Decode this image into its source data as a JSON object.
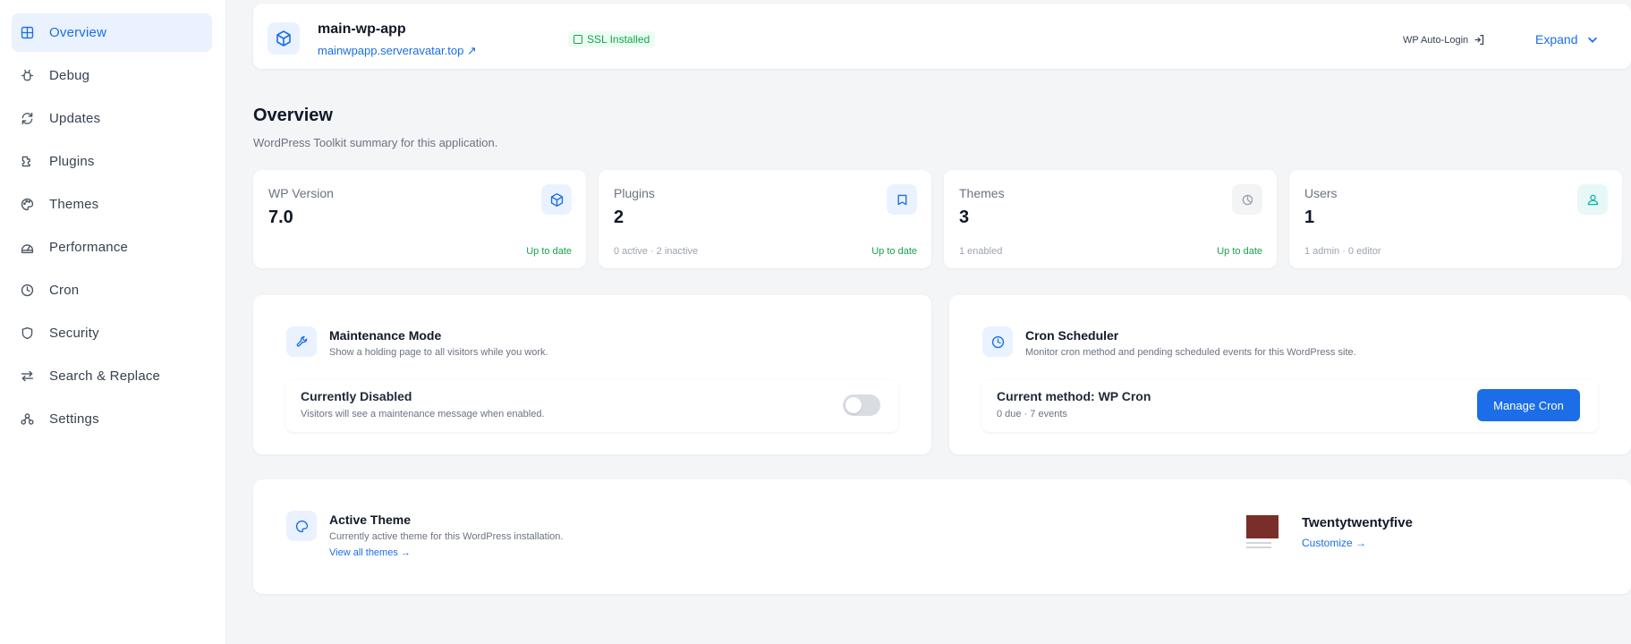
{
  "sidebar": {
    "items": [
      {
        "label": "Overview",
        "icon": "grid-icon",
        "active": true
      },
      {
        "label": "Debug",
        "icon": "bug-icon"
      },
      {
        "label": "Updates",
        "icon": "refresh-icon"
      },
      {
        "label": "Plugins",
        "icon": "puzzle-icon"
      },
      {
        "label": "Themes",
        "icon": "palette-icon"
      },
      {
        "label": "Performance",
        "icon": "gauge-icon"
      },
      {
        "label": "Cron",
        "icon": "clock-icon"
      },
      {
        "label": "Security",
        "icon": "shield-icon"
      },
      {
        "label": "Search & Replace",
        "icon": "swap-icon"
      },
      {
        "label": "Settings",
        "icon": "settings-icon"
      }
    ]
  },
  "header": {
    "app_name": "main-wp-app",
    "domain": "mainwpapp.serveravatar.top ↗",
    "ssl_badge": "SSL Installed",
    "wp_login": "WP Auto-Login",
    "expand": "Expand"
  },
  "overview": {
    "title": "Overview",
    "subtitle": "WordPress Toolkit summary for this application."
  },
  "stats": [
    {
      "label": "WP Version",
      "value": "7.0",
      "note": "",
      "status": "Up to date",
      "icon": "cube-icon",
      "icon_bg": "#eaf2ff",
      "icon_color": "#1b6ee8"
    },
    {
      "label": "Plugins",
      "value": "2",
      "note": "0 active · 2 inactive",
      "status": "Up to date",
      "icon": "puzzle-icon",
      "icon_bg": "#eaf2ff",
      "icon_color": "#1b6ee8"
    },
    {
      "label": "Themes",
      "value": "3",
      "note": "1 enabled",
      "status": "Up to date",
      "icon": "palette-icon",
      "icon_bg": "#f3f4f6",
      "icon_color": "#9ca3af"
    },
    {
      "label": "Users",
      "value": "1",
      "note": "1 admin · 0 editor",
      "status": "",
      "icon": "user-icon",
      "icon_bg": "#e7f8f8",
      "icon_color": "#14b8a6"
    }
  ],
  "maintenance": {
    "title": "Maintenance Mode",
    "desc": "Show a holding page to all visitors while you work.",
    "state_title": "Currently Disabled",
    "state_desc": "Visitors will see a maintenance message when enabled."
  },
  "cron": {
    "title": "Cron Scheduler",
    "desc": "Monitor cron method and pending scheduled events for this WordPress site.",
    "method_prefix": "Current method: ",
    "method": "WP Cron",
    "events": "0 due · 7 events",
    "button": "Manage Cron"
  },
  "active_theme": {
    "title": "Active Theme",
    "desc": "Currently active theme for this WordPress installation.",
    "view_all": "View all themes →",
    "theme_name": "Twentytwentyfive",
    "customize": "Customize →"
  }
}
